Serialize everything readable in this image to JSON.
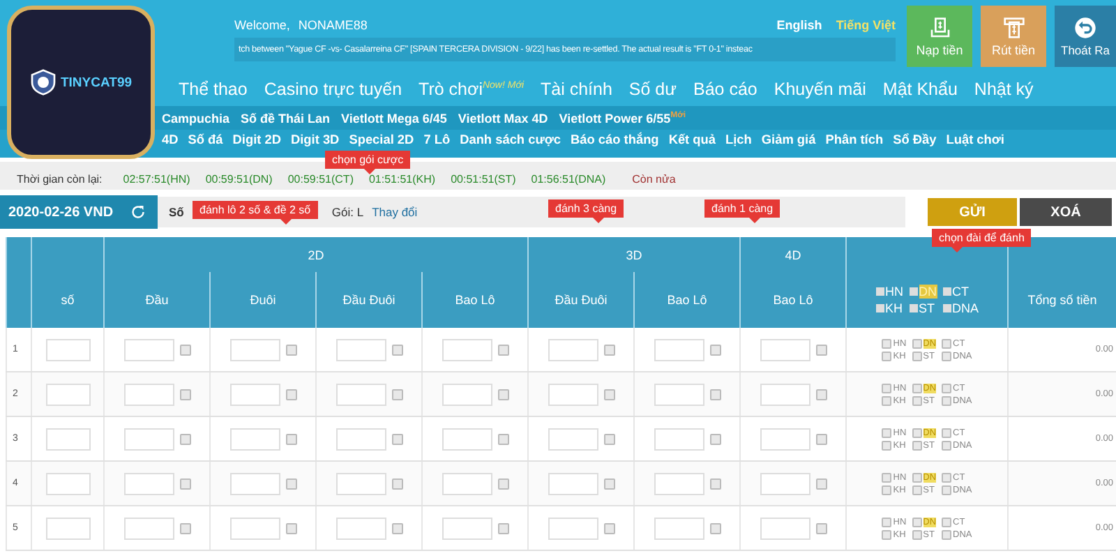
{
  "header": {
    "welcome_label": "Welcome,",
    "username": "NONAME88",
    "languages": [
      {
        "label": "English",
        "selected": false
      },
      {
        "label": "Tiếng Việt",
        "selected": true
      }
    ],
    "ticker": "tch between \"Yague CF -vs- Casalarreina CF\" [SPAIN TERCERA DIVISION - 9/22] has been re-settled. The actual result is \"FT 0-1\" insteac",
    "actions": [
      {
        "kind": "deposit",
        "label": "Nạp tiền"
      },
      {
        "kind": "withdraw",
        "label": "Rút tiền"
      },
      {
        "kind": "logout",
        "label": "Thoát Ra"
      }
    ]
  },
  "logo": {
    "name": "TINYCAT99"
  },
  "main_nav": [
    {
      "label": "Thể thao"
    },
    {
      "label": "Casino trực tuyến"
    },
    {
      "label": "Trò chơi",
      "badge": "Now! Mới"
    },
    {
      "label": "Tài chính"
    },
    {
      "label": "Số dư"
    },
    {
      "label": "Báo cáo"
    },
    {
      "label": "Khuyến mãi"
    },
    {
      "label": "Mật Khẩu"
    },
    {
      "label": "Nhật ký"
    }
  ],
  "lottery_nav": [
    {
      "label": "Campuchia"
    },
    {
      "label": "Số đề Thái Lan"
    },
    {
      "label": "Vietlott Mega 6/45"
    },
    {
      "label": "Vietlott Max 4D"
    },
    {
      "label": "Vietlott Power 6/55",
      "badge": "Mới"
    }
  ],
  "game_nav": [
    "4D",
    "Số đá",
    "Digit 2D",
    "Digit 3D",
    "Special 2D",
    "7 Lô",
    "Danh sách cược",
    "Báo cáo thắng",
    "Kết quả",
    "Lịch",
    "Giảm giá",
    "Phân tích",
    "Sổ Đầy",
    "Luật chơi"
  ],
  "countdown": {
    "label": "Thời gian còn lại:",
    "times": [
      "02:57:51(HN)",
      "00:59:51(DN)",
      "00:59:51(CT)",
      "01:51:51(KH)",
      "00:51:51(ST)",
      "01:56:51(DNA)"
    ],
    "note": "Còn nửa"
  },
  "bet_bar": {
    "date": "2020-02-26 VND",
    "prefix": "Số",
    "package_label": "Gói: L",
    "change_link": "Thay đổi",
    "submit": "GỬI",
    "clear": "XOÁ"
  },
  "table": {
    "groups": [
      "2D",
      "3D",
      "4D"
    ],
    "number_label": "số",
    "columns": [
      "Đầu",
      "Đuôi",
      "Đầu Đuôi",
      "Bao Lô",
      "Đầu Đuôi",
      "Bao Lô",
      "Bao Lô"
    ],
    "total_label": "Tổng số tiền",
    "header_stations": [
      {
        "label": "HN",
        "checked": false,
        "highlighted": false
      },
      {
        "label": "DN",
        "checked": false,
        "highlighted": true
      },
      {
        "label": "CT",
        "checked": false,
        "highlighted": false
      },
      {
        "label": "KH",
        "checked": false,
        "highlighted": false
      },
      {
        "label": "ST",
        "checked": false,
        "highlighted": false
      },
      {
        "label": "DNA",
        "checked": false,
        "highlighted": false
      }
    ],
    "rows": [
      {
        "index": "1",
        "total": "0.00",
        "cells": [
          {
            "checked": false
          },
          {
            "checked": false
          },
          {
            "checked": false
          },
          {
            "checked": false
          },
          {
            "checked": false
          },
          {
            "checked": false
          },
          {
            "checked": false
          }
        ],
        "stations": [
          {
            "label": "HN",
            "checked": false,
            "highlighted": false
          },
          {
            "label": "DN",
            "checked": false,
            "highlighted": true
          },
          {
            "label": "CT",
            "checked": false,
            "highlighted": false
          },
          {
            "label": "KH",
            "checked": false,
            "highlighted": false
          },
          {
            "label": "ST",
            "checked": false,
            "highlighted": false
          },
          {
            "label": "DNA",
            "checked": false,
            "highlighted": false
          }
        ]
      },
      {
        "index": "2",
        "total": "0.00",
        "cells": [
          {
            "checked": false
          },
          {
            "checked": false
          },
          {
            "checked": false
          },
          {
            "checked": false
          },
          {
            "checked": false
          },
          {
            "checked": false
          },
          {
            "checked": false
          }
        ],
        "stations": [
          {
            "label": "HN",
            "checked": false,
            "highlighted": false
          },
          {
            "label": "DN",
            "checked": false,
            "highlighted": true
          },
          {
            "label": "CT",
            "checked": false,
            "highlighted": false
          },
          {
            "label": "KH",
            "checked": false,
            "highlighted": false
          },
          {
            "label": "ST",
            "checked": false,
            "highlighted": false
          },
          {
            "label": "DNA",
            "checked": false,
            "highlighted": false
          }
        ]
      },
      {
        "index": "3",
        "total": "0.00",
        "cells": [
          {
            "checked": false
          },
          {
            "checked": false
          },
          {
            "checked": false
          },
          {
            "checked": false
          },
          {
            "checked": false
          },
          {
            "checked": false
          },
          {
            "checked": false
          }
        ],
        "stations": [
          {
            "label": "HN",
            "checked": false,
            "highlighted": false
          },
          {
            "label": "DN",
            "checked": false,
            "highlighted": true
          },
          {
            "label": "CT",
            "checked": false,
            "highlighted": false
          },
          {
            "label": "KH",
            "checked": false,
            "highlighted": false
          },
          {
            "label": "ST",
            "checked": false,
            "highlighted": false
          },
          {
            "label": "DNA",
            "checked": false,
            "highlighted": false
          }
        ]
      },
      {
        "index": "4",
        "total": "0.00",
        "cells": [
          {
            "checked": false
          },
          {
            "checked": false
          },
          {
            "checked": false
          },
          {
            "checked": false
          },
          {
            "checked": false
          },
          {
            "checked": false
          },
          {
            "checked": false
          }
        ],
        "stations": [
          {
            "label": "HN",
            "checked": false,
            "highlighted": false
          },
          {
            "label": "DN",
            "checked": false,
            "highlighted": true
          },
          {
            "label": "CT",
            "checked": false,
            "highlighted": false
          },
          {
            "label": "KH",
            "checked": false,
            "highlighted": false
          },
          {
            "label": "ST",
            "checked": false,
            "highlighted": false
          },
          {
            "label": "DNA",
            "checked": false,
            "highlighted": false
          }
        ]
      },
      {
        "index": "5",
        "total": "0.00",
        "cells": [
          {
            "checked": false
          },
          {
            "checked": false
          },
          {
            "checked": false
          },
          {
            "checked": false
          },
          {
            "checked": false
          },
          {
            "checked": false
          },
          {
            "checked": false
          }
        ],
        "stations": [
          {
            "label": "HN",
            "checked": false,
            "highlighted": false
          },
          {
            "label": "DN",
            "checked": false,
            "highlighted": true
          },
          {
            "label": "CT",
            "checked": false,
            "highlighted": false
          },
          {
            "label": "KH",
            "checked": false,
            "highlighted": false
          },
          {
            "label": "ST",
            "checked": false,
            "highlighted": false
          },
          {
            "label": "DNA",
            "checked": false,
            "highlighted": false
          }
        ]
      }
    ]
  },
  "callouts": [
    {
      "text": "chọn gói cược"
    },
    {
      "text": "đánh lô 2 số & đề 2 số"
    },
    {
      "text": "đánh 3 càng"
    },
    {
      "text": "đánh 1 càng"
    },
    {
      "text": "chọn đài để đánh"
    }
  ]
}
